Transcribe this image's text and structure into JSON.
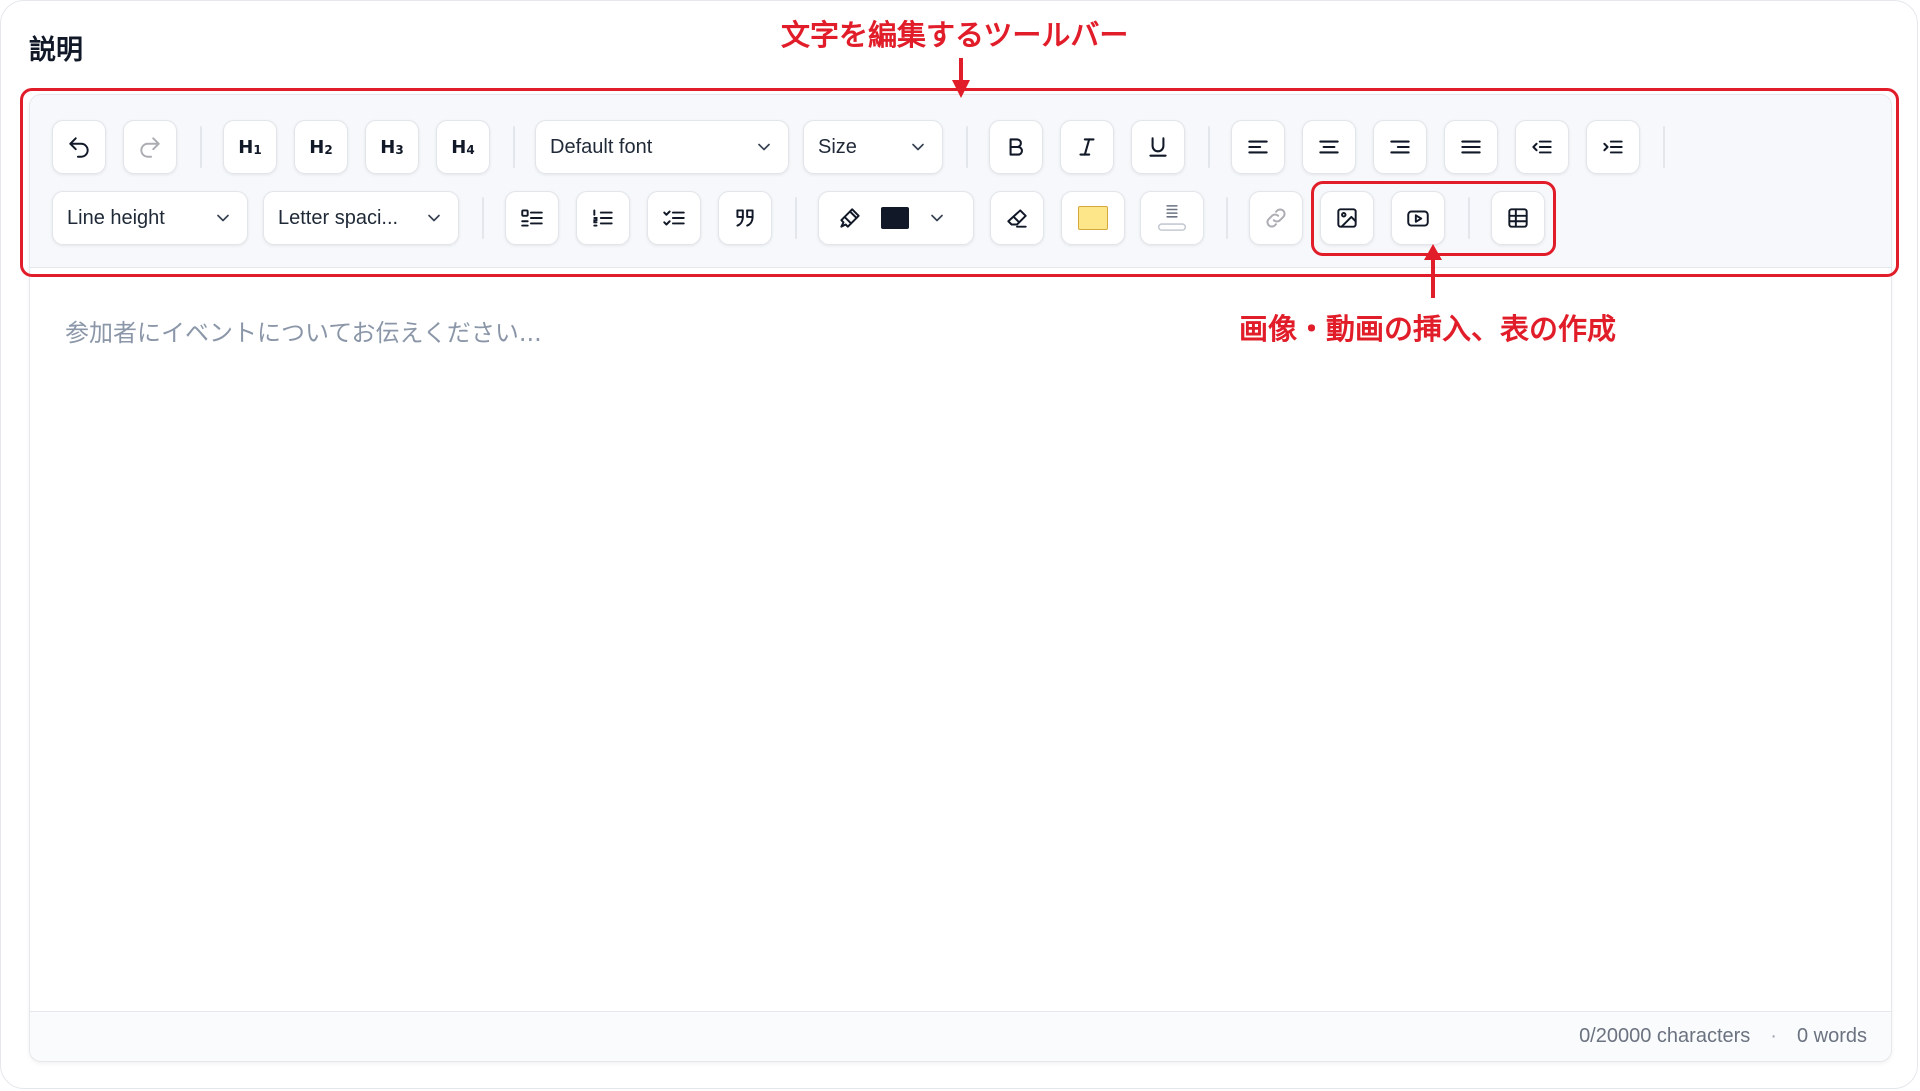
{
  "section_label": "説明",
  "annotations": {
    "toolbar_label": "文字を編集するツールバー",
    "media_label": "画像・動画の挿入、表の作成",
    "color": "#e11d2a"
  },
  "toolbar": {
    "undo_icon": "undo-icon",
    "redo_icon": "redo-icon",
    "headings": [
      {
        "main": "H",
        "sub": "1"
      },
      {
        "main": "H",
        "sub": "2"
      },
      {
        "main": "H",
        "sub": "3"
      },
      {
        "main": "H",
        "sub": "4"
      }
    ],
    "font_select": "Default font",
    "size_select": "Size",
    "line_height_select": "Line height",
    "letter_spacing_select": "Letter spaci...",
    "text_color": "#111827",
    "highlight_color": "#fde68a"
  },
  "editor": {
    "placeholder": "参加者にイベントについてお伝えください..."
  },
  "footer": {
    "characters": "0/20000 characters",
    "separator": "·",
    "words": "0 words"
  }
}
